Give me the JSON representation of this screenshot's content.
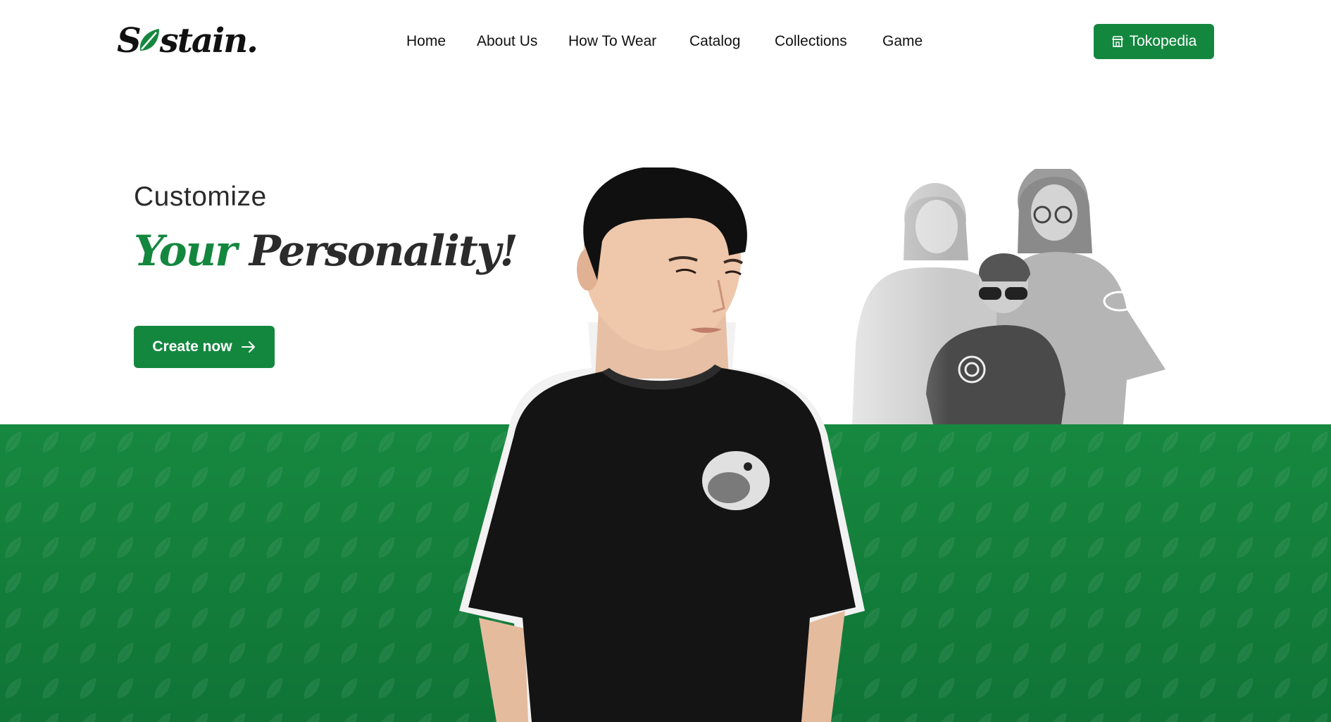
{
  "header": {
    "logo_text": "Sustain",
    "nav": [
      {
        "label": "Home"
      },
      {
        "label": "About Us"
      },
      {
        "label": "How To Wear"
      },
      {
        "label": "Catalog"
      },
      {
        "label": "Collections"
      },
      {
        "label": "Game"
      }
    ],
    "shop_button": {
      "label": "Tokopedia",
      "icon": "shop-icon"
    }
  },
  "hero": {
    "eyebrow": "Customize",
    "headline_accent": "Your",
    "headline_rest": "Personality!",
    "cta": {
      "label": "Create now",
      "icon": "arrow-right-icon"
    },
    "band_pattern_icon": "leaf-icon"
  },
  "colors": {
    "brand_green": "#14873f",
    "text_dark": "#2b2b2b",
    "background": "#ffffff"
  }
}
